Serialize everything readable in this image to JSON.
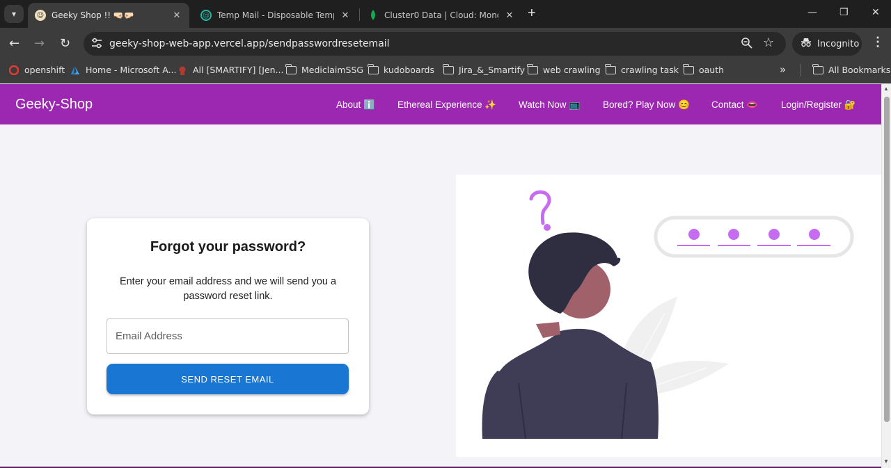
{
  "browser": {
    "tabs": [
      {
        "title": "Geeky Shop !! 🤜🏻🤛🏻",
        "active": true
      },
      {
        "title": "Temp Mail - Disposable Tempor",
        "active": false
      },
      {
        "title": "Cluster0 Data | Cloud: MongoDB",
        "active": false
      }
    ],
    "url": "geeky-shop-web-app.vercel.app/sendpasswordresetemail",
    "incognito_label": "Incognito",
    "bookmarks": [
      {
        "label": "openshift",
        "icon": "openshift-icon"
      },
      {
        "label": "Home - Microsoft A...",
        "icon": "azure-icon"
      },
      {
        "label": "All [SMARTIFY] [Jen...",
        "icon": "jenkins-icon"
      },
      {
        "label": "MediclaimSSG",
        "icon": "folder-icon"
      },
      {
        "label": "kudoboards",
        "icon": "folder-icon"
      },
      {
        "label": "Jira_&_Smartify",
        "icon": "folder-icon"
      },
      {
        "label": "web crawling",
        "icon": "folder-icon"
      },
      {
        "label": "crawling task",
        "icon": "folder-icon"
      },
      {
        "label": "oauth",
        "icon": "folder-icon"
      }
    ],
    "overflow_label": "»",
    "all_bookmarks_label": "All Bookmarks"
  },
  "navbar": {
    "brand": "Geeky-Shop",
    "links": [
      {
        "label": "About ℹ️"
      },
      {
        "label": "Ethereal Experience ✨"
      },
      {
        "label": "Watch Now 📺"
      },
      {
        "label": "Bored? Play Now 😊"
      },
      {
        "label": "Contact 👄"
      },
      {
        "label": "Login/Register 🔐"
      }
    ]
  },
  "form": {
    "title": "Forgot your password?",
    "description": "Enter your email address and we will send you a password reset link.",
    "email_placeholder": "Email Address",
    "email_value": "",
    "submit_label": "SEND RESET EMAIL"
  },
  "colors": {
    "navbar": "#9c27b0",
    "button": "#1976d2",
    "accent": "#c56cf0",
    "figure_dark": "#3f3d56",
    "skin": "#a0616a"
  }
}
